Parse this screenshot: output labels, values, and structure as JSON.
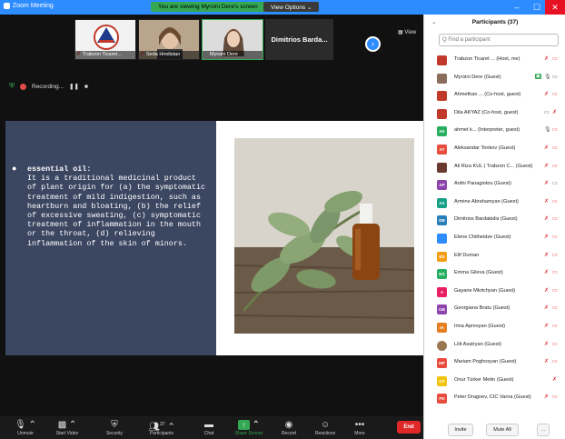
{
  "window": {
    "title": "Zoom Meeting"
  },
  "banner": {
    "sharing": "You are viewing Myrsini Dere's screen",
    "view_options": "View Options ⌄"
  },
  "window_controls": {
    "minimize": "–",
    "maximize": "☐",
    "close": "✕"
  },
  "video_strip": {
    "tiles": [
      {
        "name": "Trabzon Ticaret..."
      },
      {
        "name": "Seda Hindistan"
      },
      {
        "name": "Myrsini Dere"
      }
    ],
    "text_tile": "Dimitrios Barda...",
    "next_icon": "chevron-right-icon",
    "view_label": "View"
  },
  "recording": {
    "label": "Recording..."
  },
  "slide": {
    "heading": "essential oil:",
    "body": "It is a traditional medicinal product of plant origin for (a) the symptomatic treatment of mild indigestion, such as heartburn and bloating, (b) the relief of excessive sweating, (c) symptomatic treatment of inflammation in the mouth or the throat, (d) relieving inflammation of the skin of minors."
  },
  "toolbar": {
    "items": [
      {
        "label": "Unmute",
        "icon": "mic-off-icon"
      },
      {
        "label": "Start Video",
        "icon": "video-off-icon"
      },
      {
        "label": "Security",
        "icon": "shield-icon"
      },
      {
        "label": "Participants",
        "icon": "people-icon",
        "count": "37"
      },
      {
        "label": "Chat",
        "icon": "chat-icon"
      },
      {
        "label": "Share Screen",
        "icon": "share-screen-icon"
      },
      {
        "label": "Record",
        "icon": "record-icon"
      },
      {
        "label": "Reactions",
        "icon": "emoji-icon"
      },
      {
        "label": "More",
        "icon": "more-icon"
      }
    ],
    "end_label": "End"
  },
  "participants_panel": {
    "title": "Participants (37)",
    "search_placeholder": "Q Find a participant",
    "participants": [
      {
        "name": "Trabzon Ticaret ... (Host, me)",
        "initials": "",
        "color": "#c0392b"
      },
      {
        "name": "Myrsini Dere (Guest)",
        "initials": "",
        "color": "#8a6d5a"
      },
      {
        "name": "Ahmethan ... (Co-host, guest)",
        "initials": "",
        "color": "#c0392b"
      },
      {
        "name": "Dila AKYAZ (Co-host, guest)",
        "initials": "",
        "color": "#c0392b"
      },
      {
        "name": "ahmet k... (Interpreter, guest)",
        "initials": "AK",
        "color": "#27ae60"
      },
      {
        "name": "Aleksandar Tonkov (Guest)",
        "initials": "AT",
        "color": "#e74c3c"
      },
      {
        "name": "Ali Riza KUL | Trabzon C... (Guest)",
        "initials": "",
        "color": "#6b3a2e"
      },
      {
        "name": "Anthi Panagiotou (Guest)",
        "initials": "AP",
        "color": "#8e44ad"
      },
      {
        "name": "Armine Abrahamyan (Guest)",
        "initials": "AA",
        "color": "#16a085"
      },
      {
        "name": "Dimitrios Bardakidis (Guest)",
        "initials": "DB",
        "color": "#2980b9"
      },
      {
        "name": "Elene Chitheidze (Guest)",
        "initials": "",
        "color": "#2d8cff"
      },
      {
        "name": "Elif Duman",
        "initials": "ED",
        "color": "#f39c12"
      },
      {
        "name": "Emma Gileva (Guest)",
        "initials": "EG",
        "color": "#27ae60"
      },
      {
        "name": "Gayane Mkrtchyan (Guest)",
        "initials": "A",
        "color": "#e91e63"
      },
      {
        "name": "Georgiana Bratu (Guest)",
        "initials": "GB",
        "color": "#8e44ad"
      },
      {
        "name": "Irina Apresyan (Guest)",
        "initials": "IA",
        "color": "#e67e22"
      },
      {
        "name": "Lilit Asatryan (Guest)",
        "initials": "",
        "color": "#9b7653"
      },
      {
        "name": "Mariam Poghosyan (Guest)",
        "initials": "MP",
        "color": "#e74c3c"
      },
      {
        "name": "Onur Türker Metin (Guest)",
        "initials": "OT",
        "color": "#f1c40f"
      },
      {
        "name": "Peter Dragnev, CIC Varna (Guest)",
        "initials": "PD",
        "color": "#e74c3c"
      }
    ],
    "invite_label": "Invite",
    "mute_all_label": "Mute All",
    "more_label": "..."
  }
}
